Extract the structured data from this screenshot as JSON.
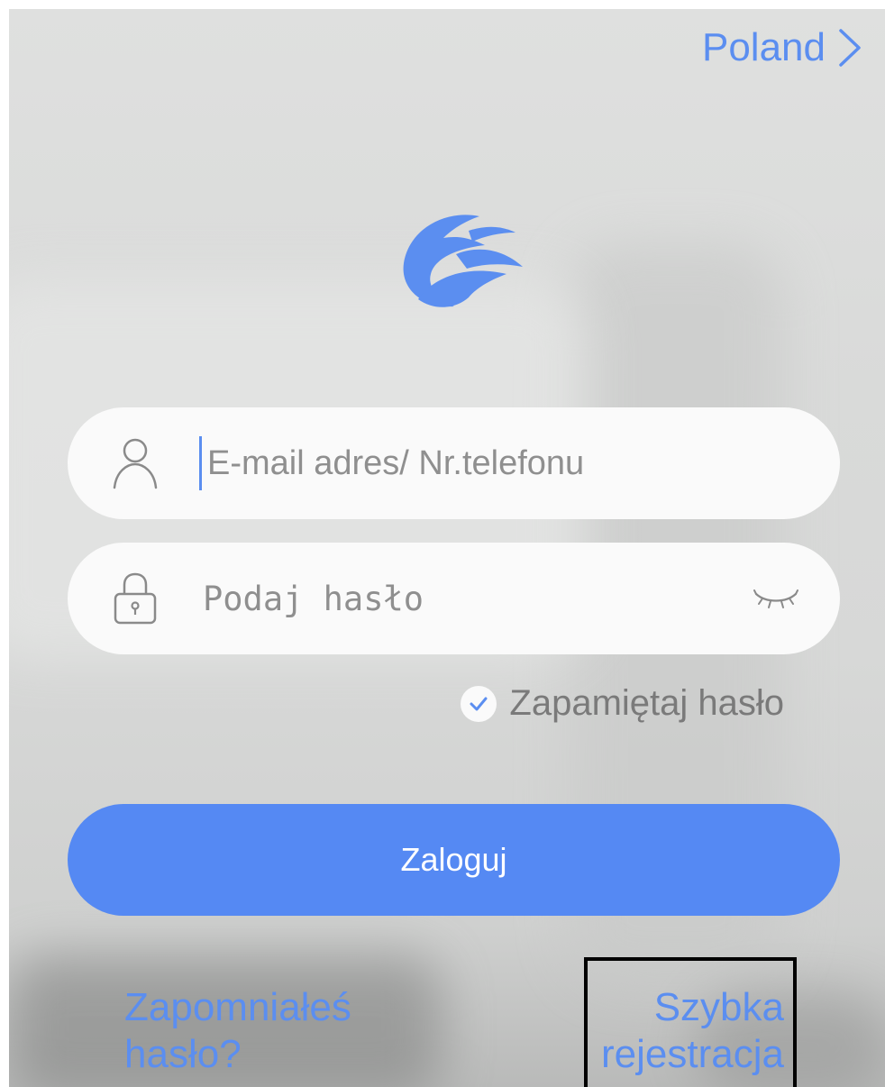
{
  "header": {
    "country": "Poland"
  },
  "icons": {
    "logo": "app-logo",
    "user": "user-icon",
    "lock": "lock-icon",
    "eye": "eye-closed-icon",
    "chevron": "chevron-right-icon",
    "check": "check-icon"
  },
  "login_form": {
    "username_placeholder": "E-mail adres/ Nr.telefonu",
    "username_value": "",
    "password_placeholder": "Podaj hasło",
    "password_value": "",
    "remember_label": "Zapamiętaj hasło",
    "remember_checked": true,
    "submit_label": "Zaloguj"
  },
  "footer": {
    "forgot_line1": "Zapomniałeś",
    "forgot_line2": "hasło?",
    "register_line1": "Szybka",
    "register_line2": "rejestracja"
  },
  "colors": {
    "accent": "#5589f3",
    "link": "#5b8ef0",
    "field_bg": "#fafafa"
  }
}
